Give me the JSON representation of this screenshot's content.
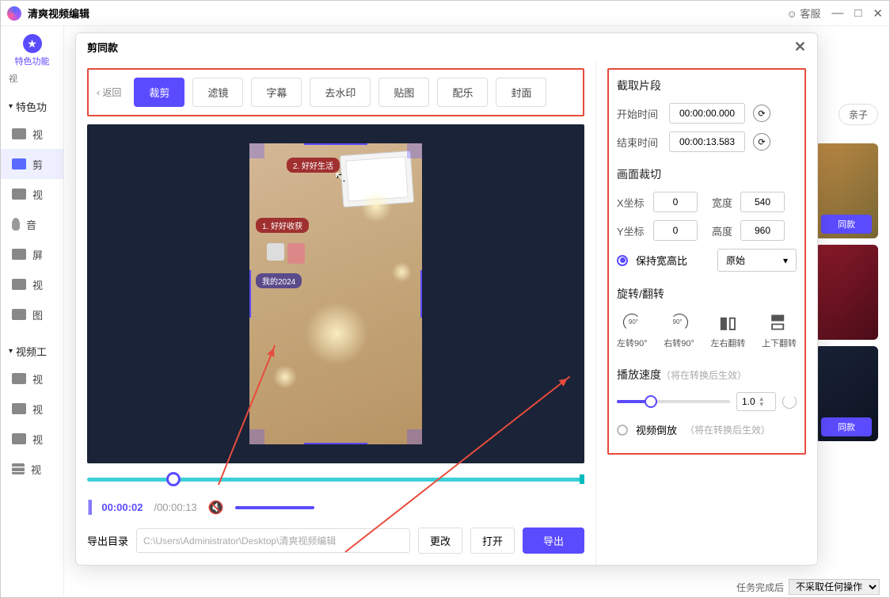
{
  "titlebar": {
    "title": "清爽视频编辑",
    "support": "客服"
  },
  "leftnav": {
    "feature": "特色功能",
    "video_tab": "视",
    "sec1": "特色功",
    "sec2": "视频工",
    "items": [
      "视",
      "剪",
      "视",
      "音",
      "屏",
      "视",
      "图"
    ],
    "items2": [
      "视",
      "视",
      "视",
      "视"
    ]
  },
  "pills": {
    "parent": "亲子"
  },
  "thumb_btn": "同款",
  "bottombar": {
    "label": "任务完成后",
    "option": "不采取任何操作"
  },
  "modal": {
    "title": "剪同款",
    "back": "返回",
    "tabs": [
      "裁剪",
      "滤镜",
      "字幕",
      "去水印",
      "贴图",
      "配乐",
      "封面"
    ],
    "preview": {
      "lbl1": "2. 好好生活",
      "lbl2": "1. 好好收获",
      "lbl3": "我的2024"
    },
    "time": {
      "cur": "00:00:02",
      "tot": "00:00:13"
    },
    "export": {
      "label": "导出目录",
      "path": "C:\\Users\\Administrator\\Desktop\\清爽视频编辑",
      "change": "更改",
      "open": "打开",
      "export": "导出"
    }
  },
  "right": {
    "clip": {
      "title": "截取片段",
      "start_l": "开始时间",
      "start_v": "00:00:00.000",
      "end_l": "结束时间",
      "end_v": "00:00:13.583"
    },
    "crop": {
      "title": "画面裁切",
      "x_l": "X坐标",
      "x_v": "0",
      "w_l": "宽度",
      "w_v": "540",
      "y_l": "Y坐标",
      "y_v": "0",
      "h_l": "高度",
      "h_v": "960",
      "keep": "保持宽高比",
      "ratio": "原始"
    },
    "rotate": {
      "title": "旋转/翻转",
      "l90": "左转90°",
      "r90": "右转90°",
      "fh": "左右翻转",
      "fv": "上下翻转"
    },
    "speed": {
      "title": "播放速度",
      "hint": "（将在转换后生效）",
      "val": "1.0",
      "reverse": "视频倒放",
      "rhint": "（将在转换后生效）"
    }
  }
}
